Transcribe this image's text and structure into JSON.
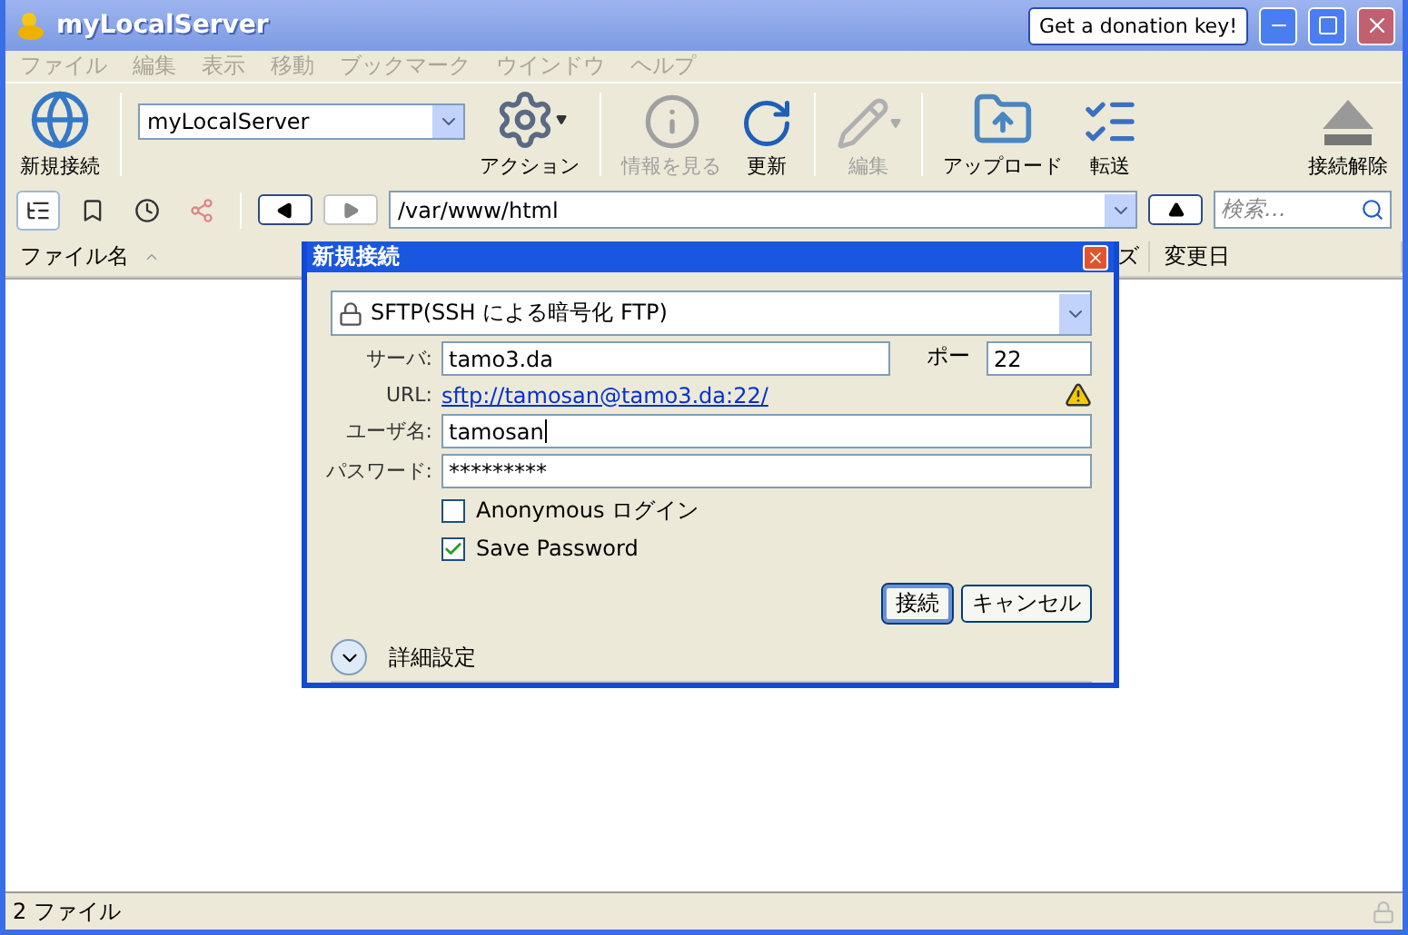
{
  "window": {
    "title": "myLocalServer",
    "donation_button": "Get a donation key!"
  },
  "menu": [
    "ファイル",
    "編集",
    "表示",
    "移動",
    "ブックマーク",
    "ウインドウ",
    "ヘルプ"
  ],
  "toolbar": {
    "groups": [
      [
        {
          "kind": "button",
          "label": "新規接続",
          "disabled": false,
          "menu": false
        }
      ],
      [
        {
          "kind": "select",
          "value": "myLocalServer"
        },
        {
          "kind": "button",
          "label": "アクション",
          "disabled": false,
          "menu": true
        }
      ],
      [
        {
          "kind": "button",
          "label": "情報を見る",
          "disabled": true,
          "menu": false
        },
        {
          "kind": "button",
          "label": "更新",
          "disabled": false,
          "menu": false
        }
      ],
      [
        {
          "kind": "button",
          "label": "編集",
          "disabled": true,
          "menu": true
        }
      ],
      [
        {
          "kind": "button",
          "label": "アップロード",
          "disabled": false,
          "menu": false
        },
        {
          "kind": "button",
          "label": "転送",
          "disabled": false,
          "menu": false
        }
      ]
    ],
    "right": [
      {
        "kind": "button",
        "label": "接続解除",
        "disabled": false,
        "menu": false
      }
    ]
  },
  "views": [
    {
      "selected": true
    },
    {
      "selected": false
    },
    {
      "selected": false
    },
    {
      "selected": false
    }
  ],
  "path": "/var/www/html",
  "search": {
    "placeholder": "検索…"
  },
  "columns": [
    {
      "label": "ファイル名",
      "sorted": true
    },
    {
      "label": "ズ",
      "sorted": false
    },
    {
      "label": "変更日",
      "sorted": false
    }
  ],
  "dialog": {
    "title": "新規接続",
    "protocol": "SFTP(SSH による暗号化 FTP)",
    "server_label": "サーバ:",
    "server": "tamo3.da",
    "port_label": "ポー",
    "port": "22",
    "url_label": "URL:",
    "url": "sftp://tamosan@tamo3.da:22/",
    "warning": true,
    "user_label": "ユーザ名:",
    "user": "tamosan",
    "password_label": "パスワード:",
    "password": "*********",
    "checkboxes": [
      {
        "label": "Anonymous ログイン",
        "checked": false
      },
      {
        "label": "Save Password",
        "checked": true
      }
    ],
    "buttons": [
      {
        "label": "接続",
        "default": true
      },
      {
        "label": "キャンセル",
        "default": false
      }
    ],
    "advanced": {
      "label": "詳細設定",
      "expanded": false
    }
  },
  "status": "2 ファイル"
}
